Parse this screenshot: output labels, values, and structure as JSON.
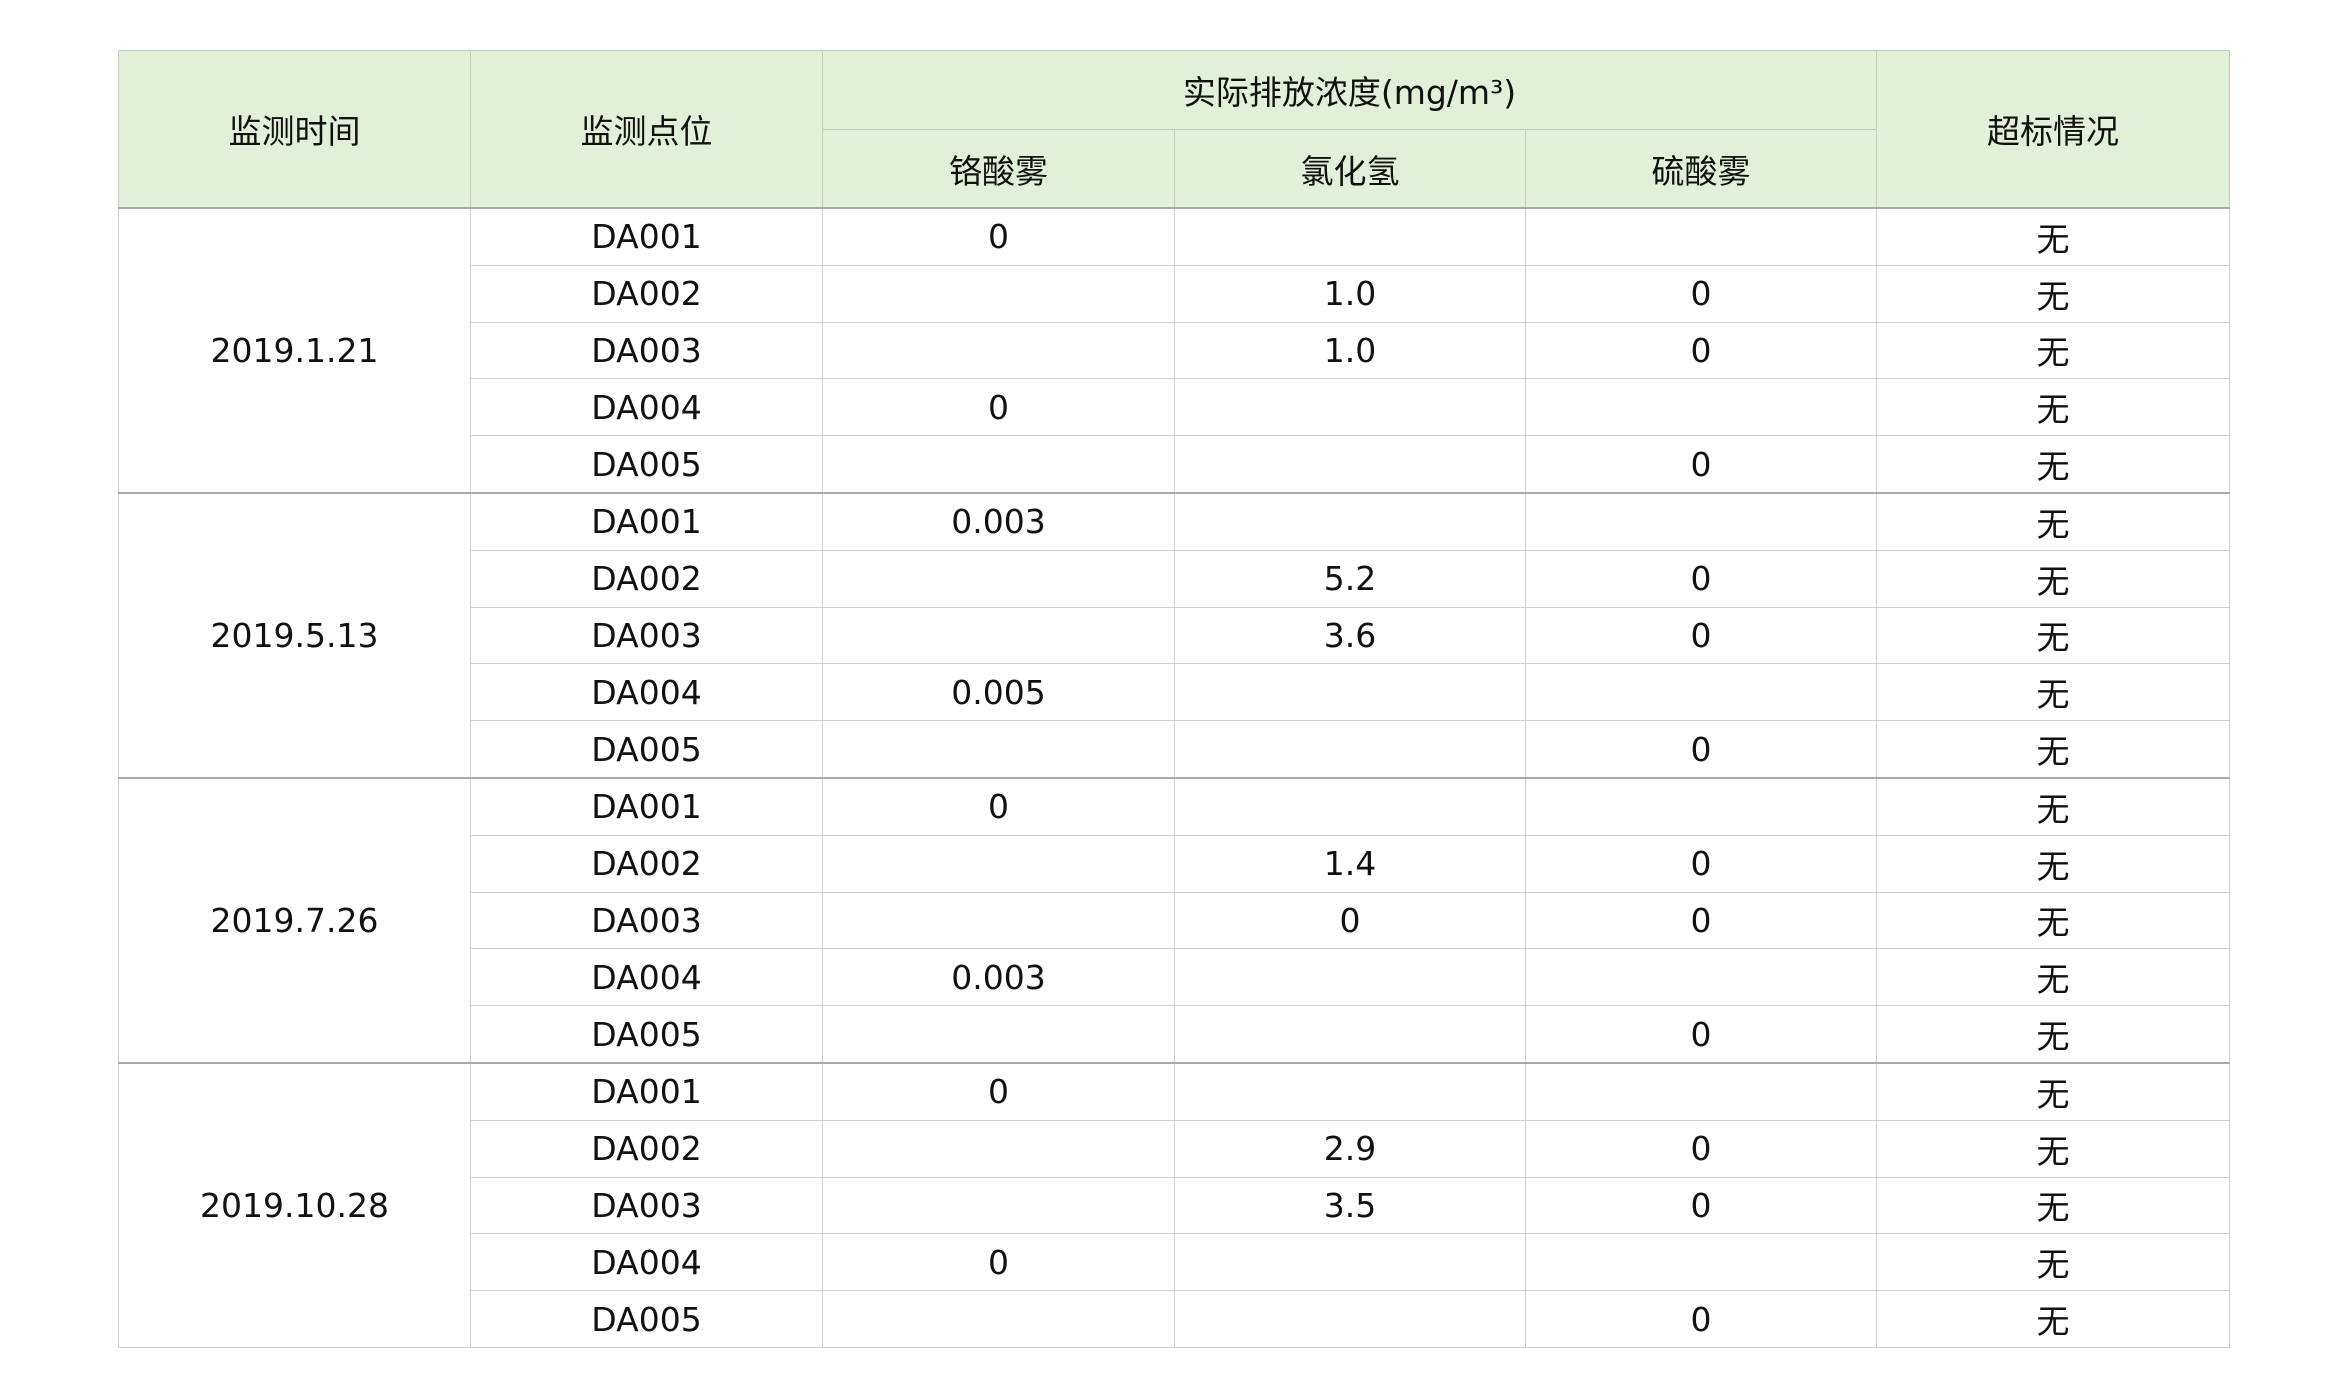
{
  "table": {
    "headers": {
      "time": "监测时间",
      "point": "监测点位",
      "concentration": "实际排放浓度(mg/m³)",
      "chromic": "铬酸雾",
      "hcl": "氯化氢",
      "sulfuric": "硫酸雾",
      "exceed": "超标情况"
    },
    "groups": [
      {
        "date": "2019.1.21",
        "rows": [
          {
            "point": "DA001",
            "chromic": "0",
            "hcl": "",
            "sulfuric": "",
            "exceed": "无"
          },
          {
            "point": "DA002",
            "chromic": "",
            "hcl": "1.0",
            "sulfuric": "0",
            "exceed": "无"
          },
          {
            "point": "DA003",
            "chromic": "",
            "hcl": "1.0",
            "sulfuric": "0",
            "exceed": "无"
          },
          {
            "point": "DA004",
            "chromic": "0",
            "hcl": "",
            "sulfuric": "",
            "exceed": "无"
          },
          {
            "point": "DA005",
            "chromic": "",
            "hcl": "",
            "sulfuric": "0",
            "exceed": "无"
          }
        ]
      },
      {
        "date": "2019.5.13",
        "rows": [
          {
            "point": "DA001",
            "chromic": "0.003",
            "hcl": "",
            "sulfuric": "",
            "exceed": "无"
          },
          {
            "point": "DA002",
            "chromic": "",
            "hcl": "5.2",
            "sulfuric": "0",
            "exceed": "无"
          },
          {
            "point": "DA003",
            "chromic": "",
            "hcl": "3.6",
            "sulfuric": "0",
            "exceed": "无"
          },
          {
            "point": "DA004",
            "chromic": "0.005",
            "hcl": "",
            "sulfuric": "",
            "exceed": "无"
          },
          {
            "point": "DA005",
            "chromic": "",
            "hcl": "",
            "sulfuric": "0",
            "exceed": "无"
          }
        ]
      },
      {
        "date": "2019.7.26",
        "rows": [
          {
            "point": "DA001",
            "chromic": "0",
            "hcl": "",
            "sulfuric": "",
            "exceed": "无"
          },
          {
            "point": "DA002",
            "chromic": "",
            "hcl": "1.4",
            "sulfuric": "0",
            "exceed": "无"
          },
          {
            "point": "DA003",
            "chromic": "",
            "hcl": "0",
            "sulfuric": "0",
            "exceed": "无"
          },
          {
            "point": "DA004",
            "chromic": "0.003",
            "hcl": "",
            "sulfuric": "",
            "exceed": "无"
          },
          {
            "point": "DA005",
            "chromic": "",
            "hcl": "",
            "sulfuric": "0",
            "exceed": "无"
          }
        ]
      },
      {
        "date": "2019.10.28",
        "rows": [
          {
            "point": "DA001",
            "chromic": "0",
            "hcl": "",
            "sulfuric": "",
            "exceed": "无"
          },
          {
            "point": "DA002",
            "chromic": "",
            "hcl": "2.9",
            "sulfuric": "0",
            "exceed": "无"
          },
          {
            "point": "DA003",
            "chromic": "",
            "hcl": "3.5",
            "sulfuric": "0",
            "exceed": "无"
          },
          {
            "point": "DA004",
            "chromic": "0",
            "hcl": "",
            "sulfuric": "",
            "exceed": "无"
          },
          {
            "point": "DA005",
            "chromic": "",
            "hcl": "",
            "sulfuric": "0",
            "exceed": "无"
          }
        ]
      }
    ]
  }
}
